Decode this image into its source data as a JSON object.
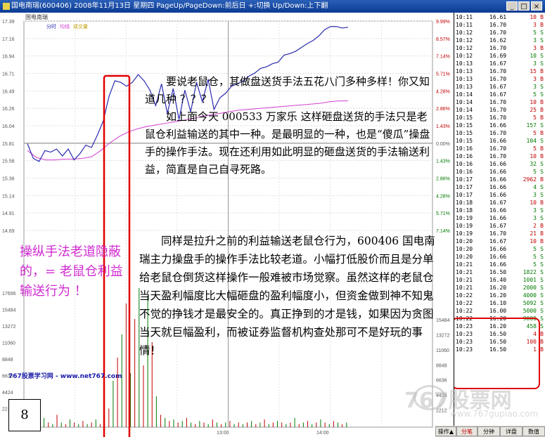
{
  "window": {
    "title": "国电南瑞(600406)  2008年11月13日 星期四  PageUp/PageDown:前后日  +:切换  Up/Down:上下翻",
    "buttons": [
      "_",
      "□",
      "×"
    ]
  },
  "chart": {
    "stock_name": "国电南瑞",
    "legend": [
      "分时",
      "均线",
      "成交量"
    ],
    "price_ticks": [
      "17.39",
      "17.16",
      "16.94",
      "16.71",
      "16.49",
      "16.26",
      "16.04",
      "15.81",
      "15.58",
      "15.36",
      "15.14",
      "14.91",
      "14.69"
    ],
    "pct_ticks": [
      "9.99%",
      "8.57%",
      "7.14%",
      "5.71%",
      "4.28%",
      "2.86%",
      "1.43%",
      "0.00%",
      "1.43%",
      "2.86%",
      "4.28%",
      "5.71%",
      "7.14%"
    ],
    "vol_ticks_left": [
      "17696",
      "15484",
      "13272",
      "11060",
      "8848",
      "6636",
      "4424",
      "2212"
    ],
    "vol_ticks_right": [
      "15484",
      "13272",
      "11060",
      "8848",
      "6636",
      "4424",
      "2212"
    ],
    "time_labels": [
      "13:00",
      "14:00"
    ],
    "price_series": [
      15.81,
      15.62,
      15.58,
      15.72,
      15.7,
      15.74,
      15.65,
      15.74,
      15.6,
      15.68,
      15.79,
      15.76,
      15.92,
      16.1,
      16.42,
      16.62,
      16.6,
      16.55,
      16.6,
      16.7,
      16.62,
      16.5,
      16.3,
      16.58,
      16.2,
      16.52,
      16.12,
      16.5,
      16.22,
      16.6,
      16.35,
      16.64,
      16.25,
      16.4,
      16.46,
      16.55,
      16.58,
      16.62,
      16.68,
      16.72,
      16.78,
      16.8,
      16.84,
      16.86,
      16.95,
      16.97,
      17.0,
      17.05,
      17.1,
      17.14,
      17.2,
      17.28,
      17.32,
      17.32,
      17.3,
      17.31
    ],
    "avg_series": [
      15.72,
      15.63,
      15.6,
      15.6,
      15.61,
      15.61,
      15.62,
      15.64,
      15.72,
      15.82,
      15.9,
      15.96,
      16.0,
      16.03,
      16.05,
      16.07,
      16.09,
      16.11,
      16.13,
      16.16,
      16.18,
      16.2,
      16.22,
      16.24,
      16.25,
      16.26,
      16.27,
      16.28,
      16.29,
      16.3,
      16.31,
      16.32,
      16.33,
      16.35,
      16.36,
      16.36
    ]
  },
  "tape": {
    "rows": [
      {
        "t": "10:11",
        "p": "16.61",
        "v": "10",
        "s": "B",
        "c": "red"
      },
      {
        "t": "10:11",
        "p": "16.70",
        "v": "3",
        "s": "B",
        "c": "red"
      },
      {
        "t": "10:12",
        "p": "16.70",
        "v": "5",
        "s": "S",
        "c": "grn"
      },
      {
        "t": "10:12",
        "p": "16.62",
        "v": "3",
        "s": "S",
        "c": "grn"
      },
      {
        "t": "10:12",
        "p": "16.70",
        "v": "3",
        "s": "B",
        "c": "red"
      },
      {
        "t": "10:12",
        "p": "16.69",
        "v": "10",
        "s": "S",
        "c": "grn"
      },
      {
        "t": "10:13",
        "p": "16.67",
        "v": "3",
        "s": "S",
        "c": "grn"
      },
      {
        "t": "10:13",
        "p": "16.70",
        "v": "15",
        "s": "B",
        "c": "red"
      },
      {
        "t": "10:13",
        "p": "16.70",
        "v": "3",
        "s": "B",
        "c": "red"
      },
      {
        "t": "10:13",
        "p": "16.67",
        "v": "3",
        "s": "S",
        "c": "grn"
      },
      {
        "t": "10:14",
        "p": "16.67",
        "v": "5",
        "s": "S",
        "c": "grn"
      },
      {
        "t": "10:14",
        "p": "16.70",
        "v": "10",
        "s": "B",
        "c": "red"
      },
      {
        "t": "10:14",
        "p": "16.70",
        "v": "25",
        "s": "B",
        "c": "red"
      },
      {
        "t": "10:15",
        "p": "16.70",
        "v": "5",
        "s": "B",
        "c": "red"
      },
      {
        "t": "10:15",
        "p": "16.66",
        "v": "157",
        "s": "S",
        "c": "grn"
      },
      {
        "t": "10:15",
        "p": "16.70",
        "v": "5",
        "s": "B",
        "c": "red"
      },
      {
        "t": "10:15",
        "p": "16.66",
        "v": "104",
        "s": "S",
        "c": "grn"
      },
      {
        "t": "10:16",
        "p": "16.70",
        "v": "5",
        "s": "B",
        "c": "red"
      },
      {
        "t": "10:16",
        "p": "16.70",
        "v": "10",
        "s": "B",
        "c": "red"
      },
      {
        "t": "10:16",
        "p": "16.66",
        "v": "32",
        "s": "S",
        "c": "grn"
      },
      {
        "t": "10:16",
        "p": "16.66",
        "v": "5",
        "s": "S",
        "c": "grn"
      },
      {
        "t": "10:17",
        "p": "16.66",
        "v": "2962",
        "s": "B",
        "c": "red"
      },
      {
        "t": "10:17",
        "p": "16.66",
        "v": "4",
        "s": "S",
        "c": "grn"
      },
      {
        "t": "10:17",
        "p": "16.66",
        "v": "3",
        "s": "S",
        "c": "grn"
      },
      {
        "t": "10:18",
        "p": "16.67",
        "v": "10",
        "s": "B",
        "c": "red"
      },
      {
        "t": "10:18",
        "p": "16.66",
        "v": "3",
        "s": "S",
        "c": "grn"
      },
      {
        "t": "10:19",
        "p": "16.66",
        "v": "3",
        "s": "S",
        "c": "grn"
      },
      {
        "t": "10:19",
        "p": "16.67",
        "v": "2",
        "s": "B",
        "c": "red"
      },
      {
        "t": "10:19",
        "p": "16.70",
        "v": "21",
        "s": "B",
        "c": "red"
      },
      {
        "t": "10:20",
        "p": "16.67",
        "v": "10",
        "s": "B",
        "c": "red"
      },
      {
        "t": "10:20",
        "p": "16.66",
        "v": "5",
        "s": "S",
        "c": "grn"
      },
      {
        "t": "10:20",
        "p": "16.66",
        "v": "5",
        "s": "S",
        "c": "grn"
      },
      {
        "t": "10:21",
        "p": "16.66",
        "v": "5",
        "s": "S",
        "c": "grn"
      },
      {
        "t": "10:21",
        "p": "16.50",
        "v": "1822",
        "s": "S",
        "c": "grn"
      },
      {
        "t": "10:21",
        "p": "16.40",
        "v": "1001",
        "s": "S",
        "c": "grn"
      },
      {
        "t": "10:21",
        "p": "16.20",
        "v": "2000",
        "s": "S",
        "c": "grn"
      },
      {
        "t": "10:22",
        "p": "16.20",
        "v": "4000",
        "s": "S",
        "c": "grn"
      },
      {
        "t": "10:22",
        "p": "16.10",
        "v": "5092",
        "s": "S",
        "c": "grn"
      },
      {
        "t": "10:22",
        "p": "16.00",
        "v": "5000",
        "s": "S",
        "c": "grn"
      },
      {
        "t": "10:22",
        "p": "16.20",
        "v": "9000",
        "s": "S",
        "c": "grn"
      },
      {
        "t": "10:23",
        "p": "16.20",
        "v": "458",
        "s": "S",
        "c": "grn"
      },
      {
        "t": "10:23",
        "p": "16.50",
        "v": "4",
        "s": "B",
        "c": "red"
      },
      {
        "t": "10:23",
        "p": "16.50",
        "v": "100",
        "s": "B",
        "c": "red"
      },
      {
        "t": "10:23",
        "p": "16.50",
        "v": "1",
        "s": "B",
        "c": "red"
      }
    ]
  },
  "tabs": [
    "操作▲",
    "分笔",
    "分钟",
    "详盘",
    "数值"
  ],
  "article": {
    "para1": "要说老鼠仓，其做盘送货手法五花八门多种多样！你又知道几种 ？？？\n如上面今天 000533 万家乐 这样砸盘送货的手法只是老鼠仓利益输送的其中一种。是最明显的一种，也是“傻瓜”操盘手的操作手法。现在还利用如此明显的砸盘送货的手法输送利益，简直是自己自寻死路。",
    "para2": "同样是拉升之前的利益输送老鼠仓行为，600406 国电南瑞主力操盘手的操作手法比较老道。小幅打低股价而且是分单给老鼠仓倒货这样操作一般难被市场觉察。虽然这样的老鼠仓当天盈利幅度比大幅砸盘的盈利幅度小，但资金做到神不知鬼不觉的挣钱才是最安全的。真正挣到的才是钱，如果因为贪图当天就巨幅盈利，而被证券监督机构查处那可不是好玩的事情！",
    "note": "操纵手法老道隐蔽的，= 老鼠仓利益输送行为 ！",
    "site": "767股票学习网 - www.net767.com",
    "page_num": "8",
    "watermark": "767股票网",
    "watermark_url": "www.767gupiao.com"
  },
  "colors": {
    "highlight": "#e00000",
    "price": "#2a2ab0",
    "avg": "#d040d0",
    "up": "#c00000",
    "down": "#007a00"
  }
}
